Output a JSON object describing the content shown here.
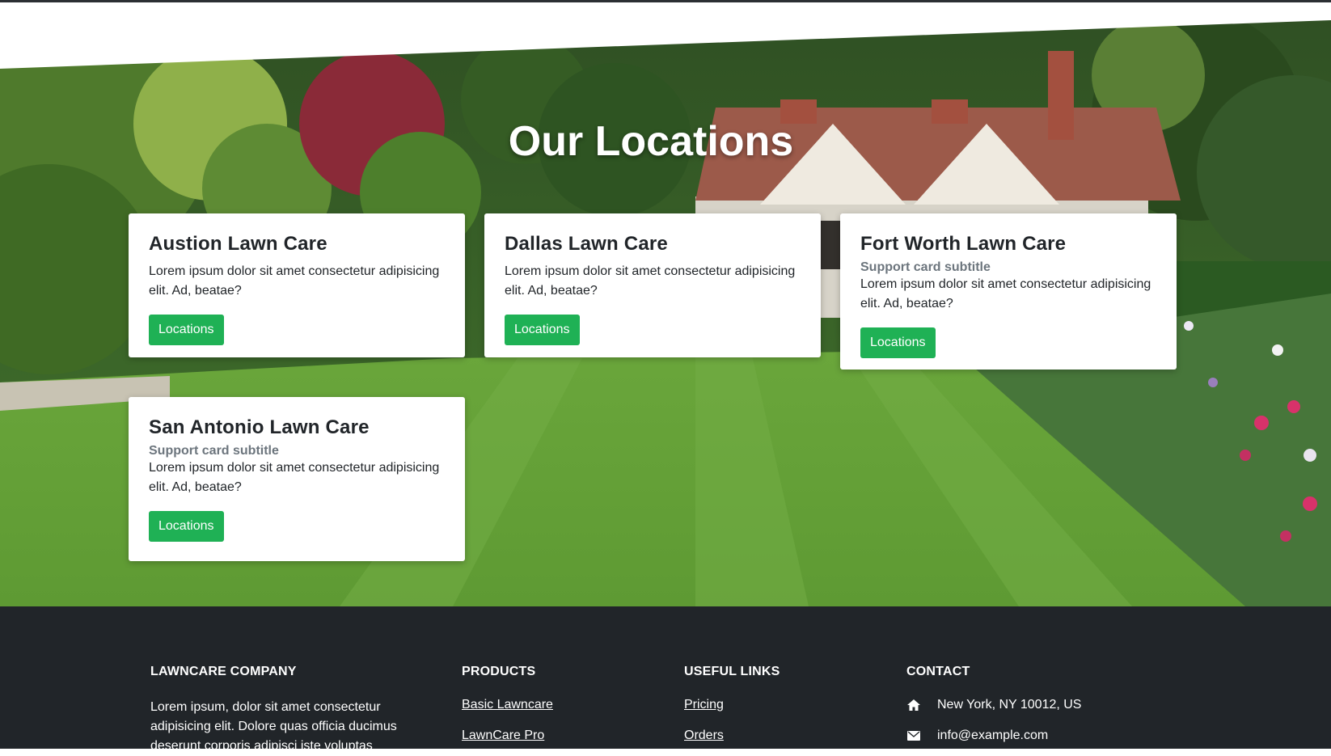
{
  "hero": {
    "title": "Our Locations"
  },
  "cards": [
    {
      "title": "Austion Lawn Care",
      "subtitle": "",
      "text": "Lorem ipsum dolor sit amet consectetur adipisicing elit. Ad, beatae?",
      "button": "Locations"
    },
    {
      "title": "Dallas Lawn Care",
      "subtitle": "",
      "text": "Lorem ipsum dolor sit amet consectetur adipisicing elit. Ad, beatae?",
      "button": "Locations"
    },
    {
      "title": "Fort Worth Lawn Care",
      "subtitle": "Support card subtitle",
      "text": "Lorem ipsum dolor sit amet consectetur adipisicing elit. Ad, beatae?",
      "button": "Locations"
    },
    {
      "title": "San Antonio Lawn Care",
      "subtitle": "Support card subtitle",
      "text": "Lorem ipsum dolor sit amet consectetur adipisicing elit. Ad, beatae?",
      "button": "Locations"
    }
  ],
  "footer": {
    "company": {
      "heading": "LAWNCARE COMPANY",
      "text": "Lorem ipsum, dolor sit amet consectetur adipisicing elit. Dolore quas officia ducimus deserunt corporis adipisci iste voluptas"
    },
    "products": {
      "heading": "PRODUCTS",
      "links": [
        "Basic Lawncare",
        "LawnCare Pro"
      ]
    },
    "useful": {
      "heading": "USEFUL LINKS",
      "links": [
        "Pricing",
        "Orders"
      ]
    },
    "contact": {
      "heading": "CONTACT",
      "address": "New York, NY 10012, US",
      "email": "info@example.com",
      "icons": [
        "home-icon",
        "envelope-icon"
      ]
    }
  },
  "colors": {
    "accent": "#1fb155",
    "footer_bg": "#212529",
    "muted": "#6c757d"
  }
}
